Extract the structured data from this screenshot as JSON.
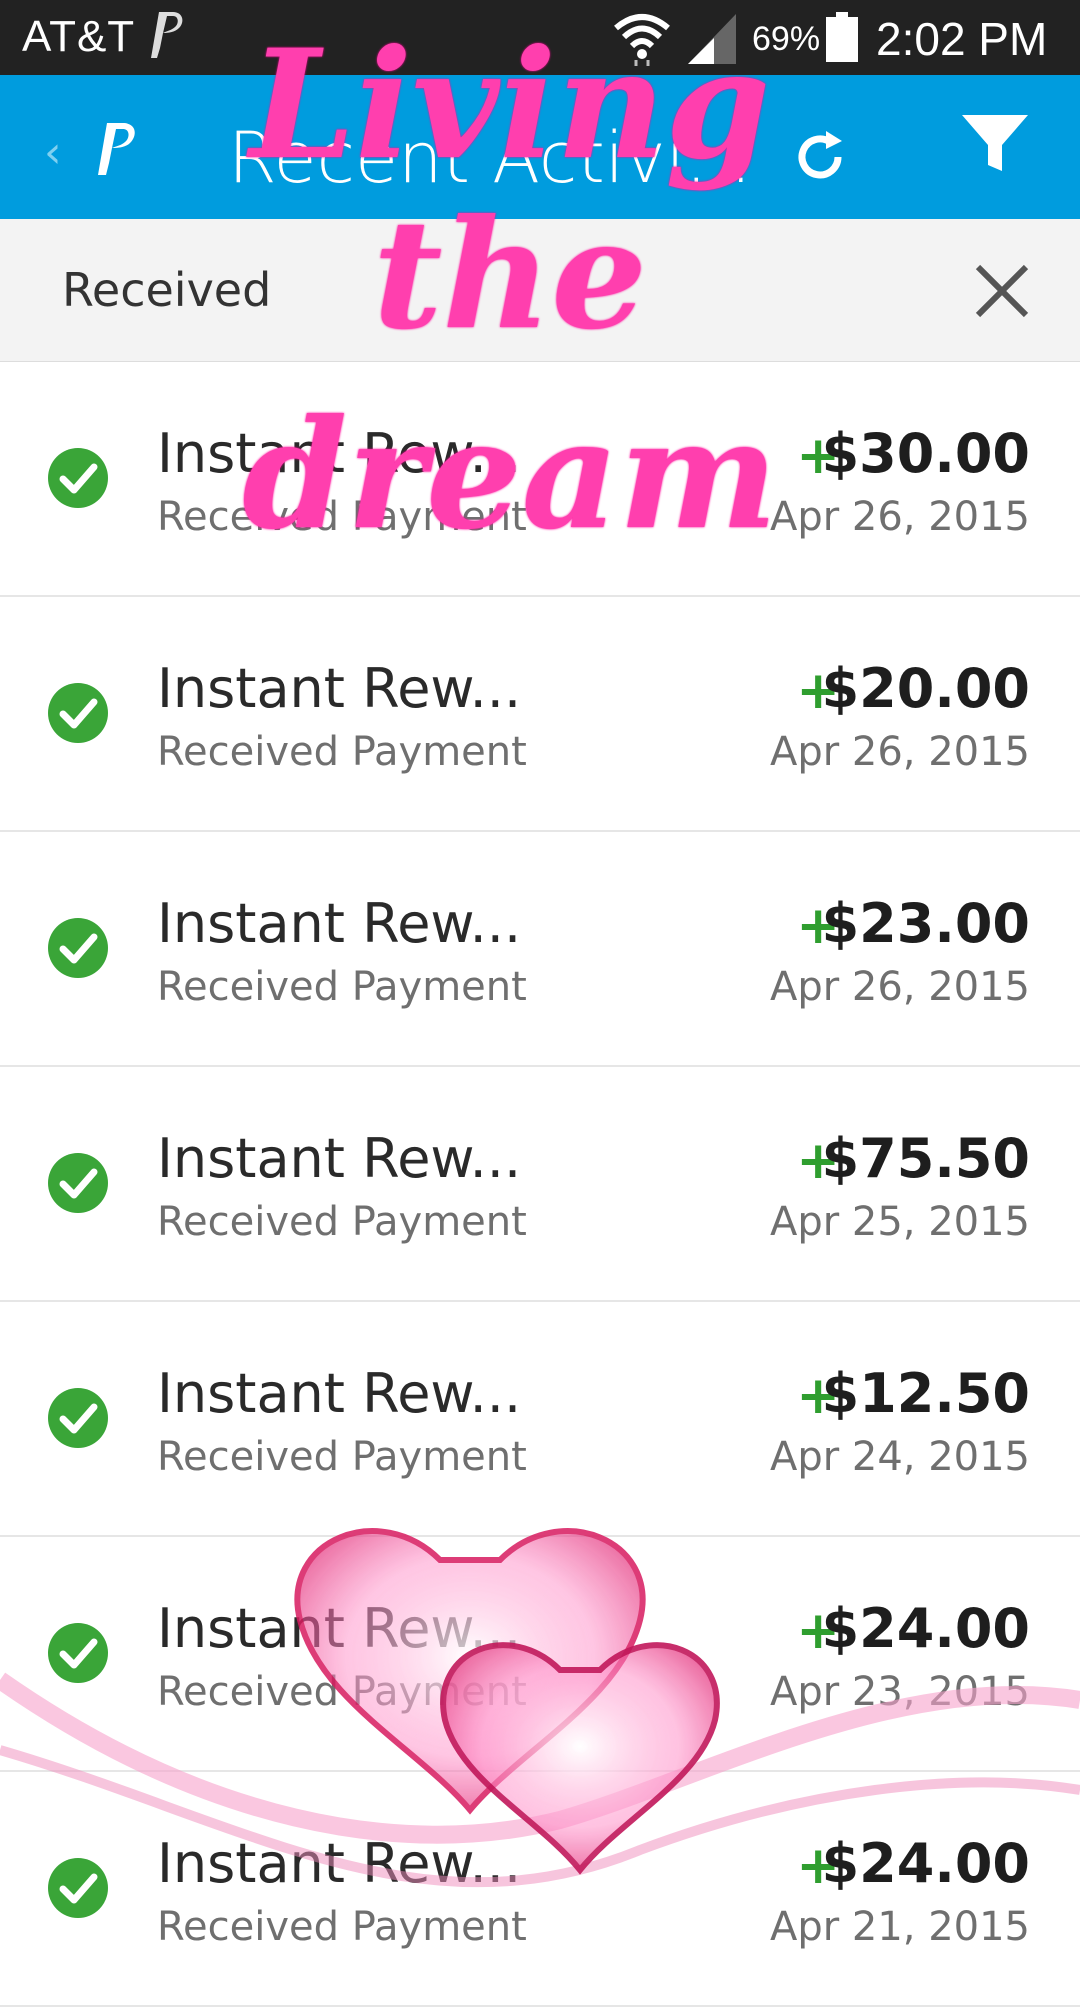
{
  "status_bar": {
    "carrier": "AT&T",
    "battery_pct": "69%",
    "time": "2:02 PM"
  },
  "app_bar": {
    "title": "Recent Activi...",
    "back_icon": "chevron-left-icon",
    "logo_icon": "paypal-logo-icon",
    "refresh_icon": "refresh-icon",
    "filter_icon": "filter-icon",
    "color": "#009cde"
  },
  "filter": {
    "label": "Received",
    "clear_icon": "close-icon"
  },
  "transactions": [
    {
      "title": "Instant Rew...",
      "subtitle": "Received Payment",
      "sign": "+",
      "amount": "$30.00",
      "date": "Apr 26, 2015"
    },
    {
      "title": "Instant Rew...",
      "subtitle": "Received Payment",
      "sign": "+",
      "amount": "$20.00",
      "date": "Apr 26, 2015"
    },
    {
      "title": "Instant Rew...",
      "subtitle": "Received Payment",
      "sign": "+",
      "amount": "$23.00",
      "date": "Apr 26, 2015"
    },
    {
      "title": "Instant Rew...",
      "subtitle": "Received Payment",
      "sign": "+",
      "amount": "$75.50",
      "date": "Apr 25, 2015"
    },
    {
      "title": "Instant Rew...",
      "subtitle": "Received Payment",
      "sign": "+",
      "amount": "$12.50",
      "date": "Apr 24, 2015"
    },
    {
      "title": "Instant Rew...",
      "subtitle": "Received Payment",
      "sign": "+",
      "amount": "$24.00",
      "date": "Apr 23, 2015"
    },
    {
      "title": "Instant Rew...",
      "subtitle": "Received Payment",
      "sign": "+",
      "amount": "$24.00",
      "date": "Apr 21, 2015"
    }
  ],
  "overlay": {
    "line1": "Living the",
    "line2": "dream",
    "color": "#ff3fae",
    "decoration": "hearts-icon"
  },
  "colors": {
    "positive": "#2f9e2f",
    "check": "#3aa538"
  }
}
